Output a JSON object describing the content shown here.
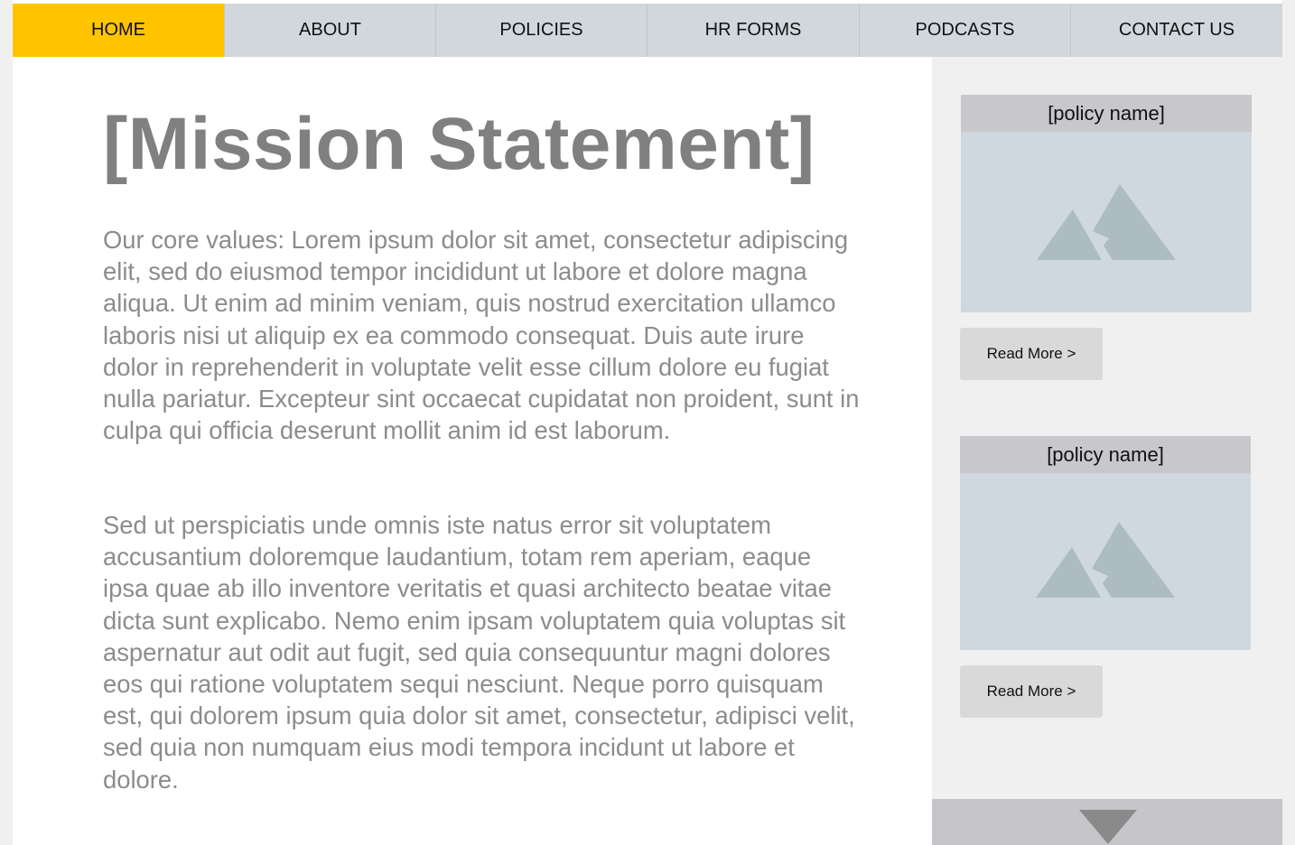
{
  "nav": {
    "items": [
      {
        "label": "HOME",
        "active": true
      },
      {
        "label": "ABOUT"
      },
      {
        "label": "POLICIES"
      },
      {
        "label": "HR FORMS"
      },
      {
        "label": "PODCASTS"
      },
      {
        "label": "CONTACT US"
      }
    ]
  },
  "main": {
    "title": "[Mission Statement]",
    "paragraphs": [
      "Our core values: Lorem ipsum dolor sit amet, consectetur adipiscing elit, sed do eiusmod tempor incididunt ut labore et dolore magna aliqua. Ut enim ad minim veniam, quis nostrud exercitation ullamco laboris nisi ut aliquip ex ea commodo consequat. Duis aute irure dolor in reprehenderit in voluptate velit esse cillum dolore eu fugiat nulla pariatur. Excepteur sint occaecat cupidatat non proident, sunt in culpa qui officia deserunt mollit anim id est laborum.",
      "Sed ut perspiciatis unde omnis iste natus error sit voluptatem accusantium doloremque laudantium, totam rem aperiam, eaque ipsa quae ab illo inventore veritatis et quasi architecto beatae vitae dicta sunt explicabo. Nemo enim ipsam voluptatem quia voluptas sit aspernatur aut odit aut fugit, sed quia consequuntur magni dolores eos qui ratione voluptatem sequi nesciunt. Neque porro quisquam est, qui dolorem ipsum quia dolor sit amet, consectetur, adipisci velit, sed quia non numquam eius modi tempora incidunt ut labore et dolore."
    ]
  },
  "sidebar": {
    "cards": [
      {
        "title": "[policy name]",
        "button": "Read More >",
        "image_icon": "image-placeholder-icon"
      },
      {
        "title": "[policy name]",
        "button": "Read More >",
        "image_icon": "image-placeholder-icon"
      }
    ],
    "scroll_icon": "triangle-down-icon"
  },
  "colors": {
    "accent": "#ffc400",
    "nav_bg": "#d0d8dd",
    "sidebar_bg": "#f0f0f0",
    "text_muted": "#8c8c8c"
  }
}
